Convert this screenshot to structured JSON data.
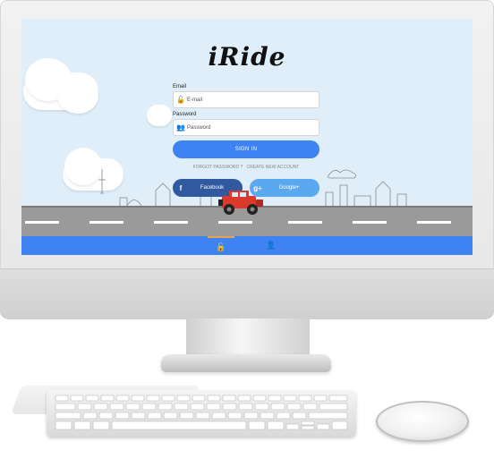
{
  "app": {
    "logo": "iRide"
  },
  "login": {
    "email_label": "Email",
    "email_placeholder": "E-mail",
    "password_label": "Password",
    "password_placeholder": "Password",
    "signin_label": "SIGN IN",
    "forgot_link": "FORGOT PASSWORD ?",
    "create_link": "CREATE NEW ACCOUNT"
  },
  "social": {
    "facebook_label": "Facebook",
    "facebook_icon": "f",
    "google_label": "Google+",
    "google_icon": "g+"
  },
  "bottom_tabs": [
    {
      "icon": "lock-icon",
      "glyph": "🔓",
      "active": true
    },
    {
      "icon": "user-icon",
      "glyph": "👤",
      "active": false
    }
  ],
  "colors": {
    "primary": "#3f82f3",
    "facebook": "#3059a0",
    "google": "#5aa8f0",
    "sky": "#dfeef8",
    "car": "#d93a2b"
  }
}
